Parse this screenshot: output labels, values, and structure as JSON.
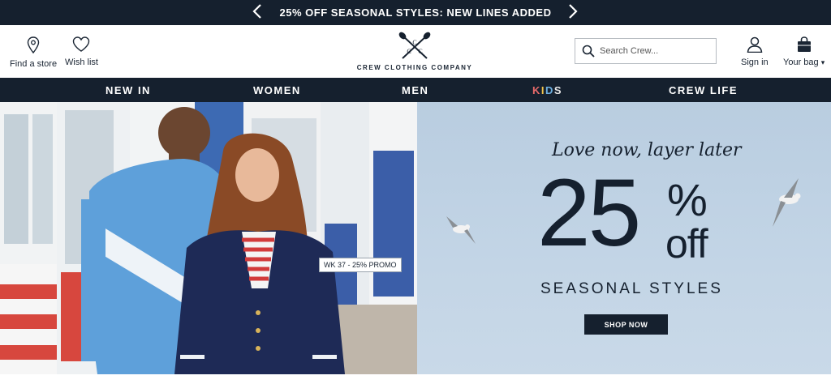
{
  "promo": {
    "text": "25% OFF SEASONAL STYLES: NEW LINES ADDED",
    "prev_icon": "chevron-left-icon",
    "next_icon": "chevron-right-icon"
  },
  "header": {
    "find_store": "Find a store",
    "wish_list": "Wish list",
    "logo_text": "CREW CLOTHING COMPANY",
    "logo_mark": "CC",
    "search_placeholder": "Search Crew...",
    "sign_in": "Sign in",
    "your_bag": "Your bag",
    "bag_caret": "▾"
  },
  "nav": {
    "items": [
      "NEW IN",
      "WOMEN",
      "MEN",
      "KIDS",
      "CREW LIFE"
    ]
  },
  "hero": {
    "tagline": "Love now, layer later",
    "big_number": "25",
    "percent": "%",
    "off": "off",
    "subtitle": "SEASONAL STYLES",
    "cta": "SHOP NOW",
    "photo_tag": "WK 37 - 25% PROMO"
  },
  "colors": {
    "navy": "#15202e",
    "sky": "#c3d5e6",
    "kids_k": "#e86a6a",
    "kids_i": "#f0c44c",
    "kids_d": "#6fb0e0",
    "kids_s": "#e8e8e8"
  }
}
